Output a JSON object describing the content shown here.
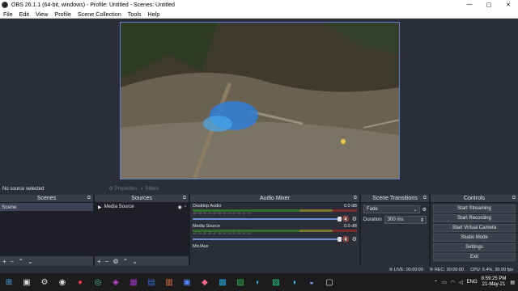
{
  "window": {
    "title": "OBS 26.1.1 (64-bit, windows) - Profile: Untitled - Scenes: Untitled",
    "min": "—",
    "max": "▢",
    "close": "✕"
  },
  "menu": [
    "File",
    "Edit",
    "View",
    "Profile",
    "Scene Collection",
    "Tools",
    "Help"
  ],
  "source_bar": {
    "status": "No source selected",
    "properties": "Properties",
    "filters": "Filters"
  },
  "scenes": {
    "title": "Scenes",
    "items": [
      "Scene"
    ]
  },
  "sources": {
    "title": "Sources",
    "items": [
      "Media Source"
    ]
  },
  "mixer": {
    "title": "Audio Mixer",
    "channels": [
      {
        "name": "Desktop Audio",
        "db": "0.0 dB"
      },
      {
        "name": "Media Source",
        "db": "0.0 dB"
      },
      {
        "name": "Mic/Aux",
        "db": ""
      }
    ],
    "ticks": "-60 -55 -50 -45 -40 -35 -30 -25 -20 -15 -10 -5 0"
  },
  "transitions": {
    "title": "Scene Transitions",
    "type": "Fade",
    "duration_label": "Duration",
    "duration": "300 ms"
  },
  "controls": {
    "title": "Controls",
    "buttons": [
      "Start Streaming",
      "Start Recording",
      "Start Virtual Camera",
      "Studio Mode",
      "Settings",
      "Exit"
    ]
  },
  "status": {
    "live": "LIVE: 00:00:00",
    "rec": "REC: 00:00:00",
    "cpu": "CPU: 6.4%, 30.00 fps"
  },
  "taskbar": {
    "lang": "ENG",
    "time": "8:59:25 PM",
    "date": "21-May-21"
  },
  "colors": {
    "accent": "#5a7fc7",
    "mute": "#e24c4c",
    "bg": "#2b2e38"
  }
}
